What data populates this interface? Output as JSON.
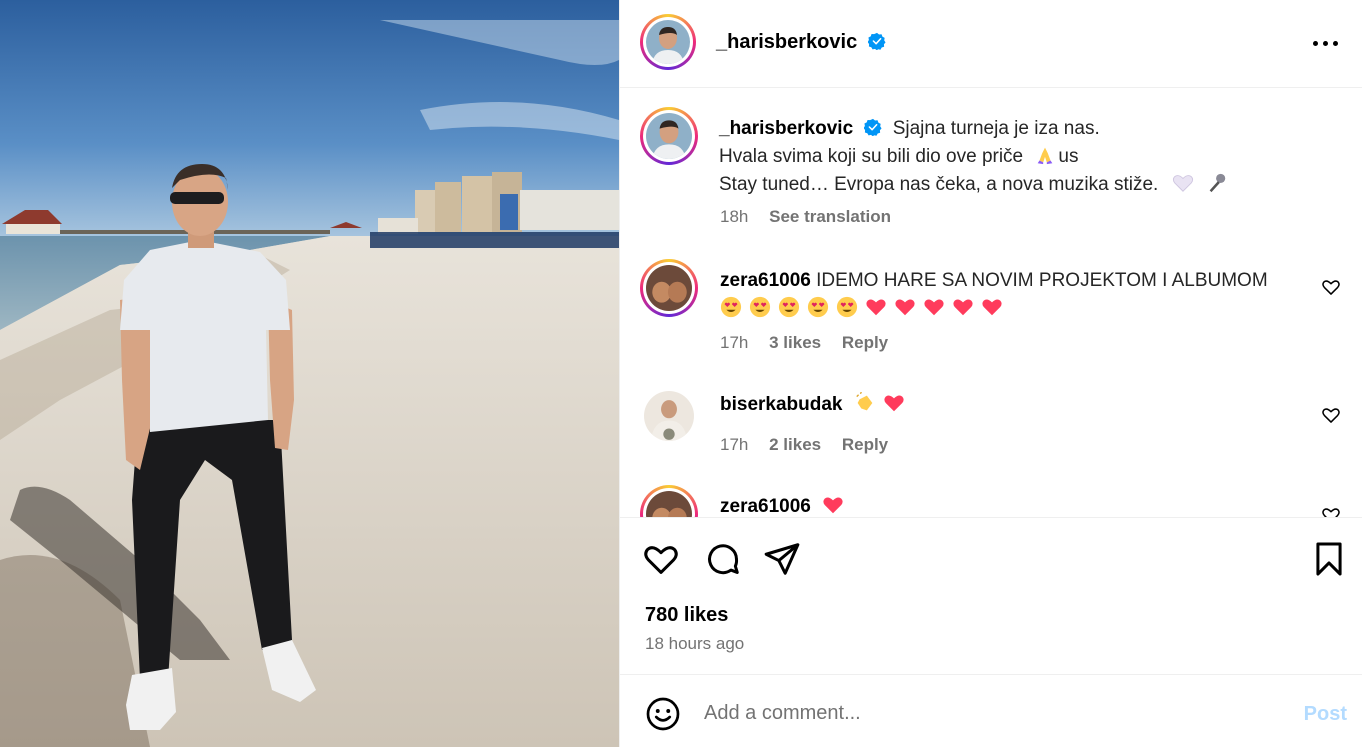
{
  "post": {
    "author": "_harisberkovic",
    "verified": true,
    "caption_lines": [
      "Sjajna turneja je iza nas.",
      "Hvala svima koji su bili dio ove priče",
      "Stay tuned… Evropa nas čeka, a nova muzika stiže."
    ],
    "caption_suffix": "us",
    "caption_age": "18h",
    "see_translation": "See translation"
  },
  "comments": [
    {
      "user": "zera61006",
      "text": "IDEMO HARE SA NOVIM PROJEKTOM I ALBUMOM",
      "age": "17h",
      "likes": "3 likes",
      "reply": "Reply"
    },
    {
      "user": "biserkabudak",
      "text": "",
      "age": "17h",
      "likes": "2 likes",
      "reply": "Reply"
    },
    {
      "user": "zera61006",
      "text": ""
    }
  ],
  "footer": {
    "likes": "780 likes",
    "time_ago": "18 hours ago",
    "comment_placeholder": "Add a comment...",
    "post_label": "Post"
  },
  "icons": [
    "more-icon",
    "verified-icon",
    "heart-icon",
    "comment-icon",
    "share-icon",
    "bookmark-icon",
    "emoji-icon"
  ],
  "colors": {
    "verified": "#0095f6",
    "accent_disabled": "#b3dbff",
    "heart": "#ff3b5c",
    "muted": "#737373"
  }
}
